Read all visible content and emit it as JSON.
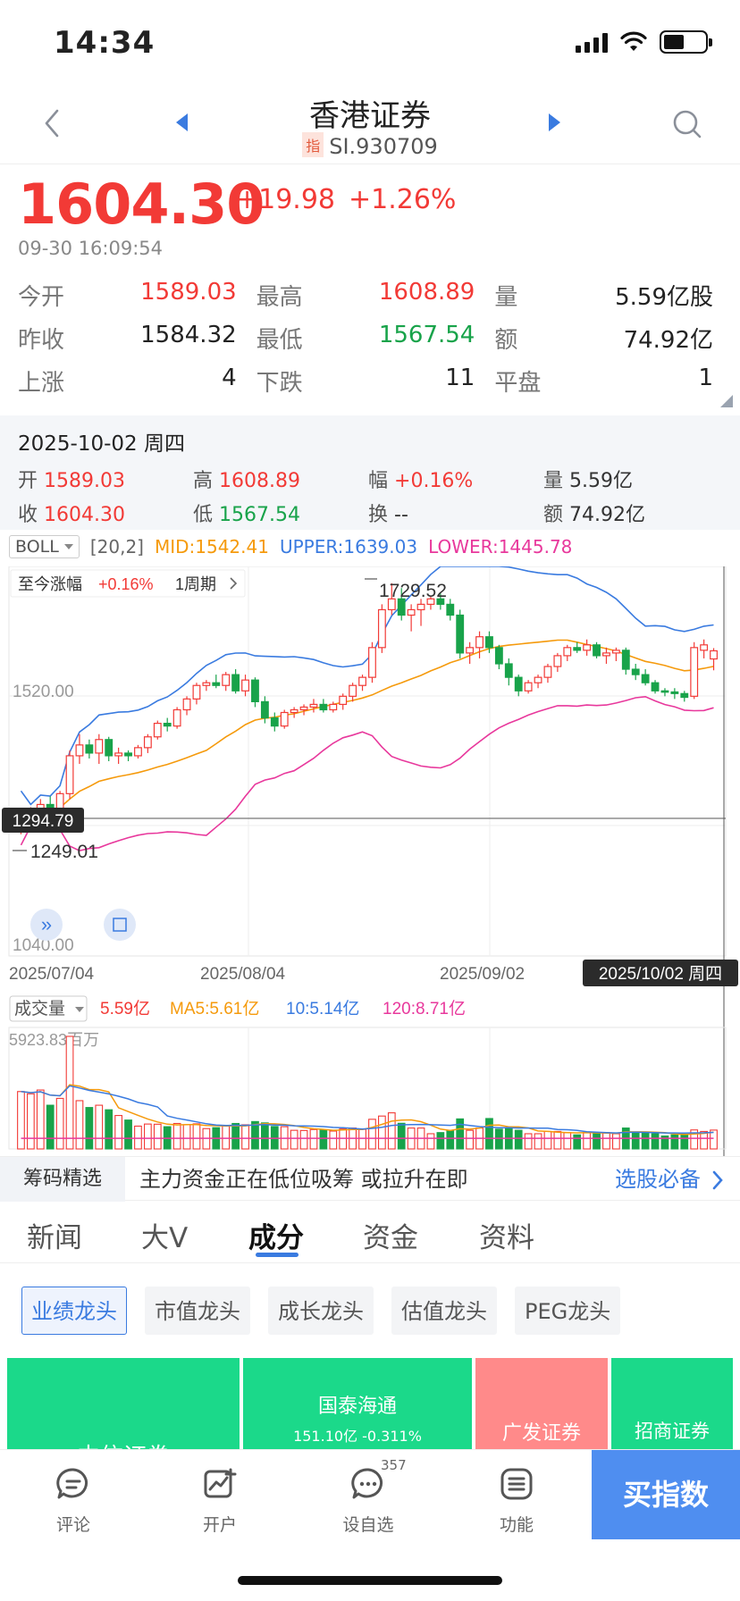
{
  "status": {
    "time": "14:34"
  },
  "nav": {
    "title": "香港证券",
    "tag": "指",
    "code": "SI.930709"
  },
  "quote": {
    "price": "1604.30",
    "change": "+19.98",
    "change_pct": "+1.26%",
    "time": "09-30 16:09:54",
    "rows": [
      [
        {
          "label": "今开",
          "value": "1589.03",
          "color": "red"
        },
        {
          "label": "最高",
          "value": "1608.89",
          "color": "red"
        },
        {
          "label": "量",
          "value": "5.59亿股",
          "color": "dark"
        }
      ],
      [
        {
          "label": "昨收",
          "value": "1584.32",
          "color": "dark"
        },
        {
          "label": "最低",
          "value": "1567.54",
          "color": "green"
        },
        {
          "label": "额",
          "value": "74.92亿",
          "color": "dark"
        }
      ],
      [
        {
          "label": "上涨",
          "value": "4",
          "color": "dark"
        },
        {
          "label": "下跌",
          "value": "11",
          "color": "dark"
        },
        {
          "label": "平盘",
          "value": "1",
          "color": "dark"
        }
      ]
    ]
  },
  "day": {
    "date": "2025-10-02 周四",
    "row1": {
      "open_l": "开",
      "open": "1589.03",
      "high_l": "高",
      "high": "1608.89",
      "amp_l": "幅",
      "amp": "+0.16%",
      "vol_l": "量",
      "vol": "5.59亿"
    },
    "row2": {
      "close_l": "收",
      "close": "1604.30",
      "low_l": "低",
      "low": "1567.54",
      "turn_l": "换",
      "turn": "--",
      "amt_l": "额",
      "amt": "74.92亿"
    }
  },
  "indicator": {
    "name": "BOLL",
    "params": "[20,2]",
    "mid": "MID:1542.41",
    "upper": "UPPER:1639.03",
    "lower": "LOWER:1445.78",
    "colors": {
      "mid": "#f59a0c",
      "upper": "#3a7be0",
      "lower": "#e8389c"
    }
  },
  "chart": {
    "period_label": "至今涨幅",
    "period_value": "+0.16%",
    "period_unit": "1周期",
    "y_label_mid": "1520.00",
    "y_label_low": "1040.00",
    "max_label": "1729.52",
    "min_label": "1249.01",
    "crosshair_price": "1294.79",
    "crosshair_date": "2025/10/02 周四",
    "x_labels": [
      "2025/07/04",
      "2025/08/04",
      "2025/09/02"
    ]
  },
  "chart_data": [
    {
      "type": "candlestick",
      "y_range": [
        1040,
        1760
      ],
      "ohlc": [
        [
          1280,
          1300,
          1265,
          1295
        ],
        [
          1295,
          1315,
          1280,
          1305
        ],
        [
          1305,
          1330,
          1290,
          1320
        ],
        [
          1320,
          1335,
          1305,
          1310
        ],
        [
          1310,
          1345,
          1300,
          1340
        ],
        [
          1340,
          1420,
          1330,
          1410
        ],
        [
          1410,
          1450,
          1395,
          1430
        ],
        [
          1430,
          1440,
          1405,
          1415
        ],
        [
          1415,
          1450,
          1395,
          1440
        ],
        [
          1440,
          1445,
          1400,
          1410
        ],
        [
          1410,
          1425,
          1395,
          1415
        ],
        [
          1415,
          1420,
          1400,
          1410
        ],
        [
          1410,
          1430,
          1405,
          1425
        ],
        [
          1425,
          1450,
          1415,
          1445
        ],
        [
          1445,
          1475,
          1440,
          1470
        ],
        [
          1470,
          1480,
          1455,
          1465
        ],
        [
          1465,
          1500,
          1460,
          1495
        ],
        [
          1495,
          1520,
          1485,
          1515
        ],
        [
          1515,
          1545,
          1505,
          1540
        ],
        [
          1540,
          1550,
          1530,
          1545
        ],
        [
          1545,
          1560,
          1535,
          1540
        ],
        [
          1540,
          1565,
          1530,
          1560
        ],
        [
          1560,
          1570,
          1525,
          1530
        ],
        [
          1530,
          1560,
          1520,
          1550
        ],
        [
          1550,
          1555,
          1500,
          1510
        ],
        [
          1510,
          1520,
          1470,
          1480
        ],
        [
          1480,
          1490,
          1455,
          1465
        ],
        [
          1465,
          1495,
          1460,
          1490
        ],
        [
          1490,
          1500,
          1480,
          1495
        ],
        [
          1495,
          1505,
          1485,
          1500
        ],
        [
          1500,
          1515,
          1490,
          1505
        ],
        [
          1505,
          1515,
          1490,
          1495
        ],
        [
          1495,
          1510,
          1490,
          1505
        ],
        [
          1505,
          1525,
          1495,
          1520
        ],
        [
          1520,
          1545,
          1510,
          1540
        ],
        [
          1540,
          1560,
          1530,
          1555
        ],
        [
          1555,
          1620,
          1545,
          1610
        ],
        [
          1610,
          1690,
          1600,
          1680
        ],
        [
          1680,
          1729,
          1670,
          1700
        ],
        [
          1700,
          1720,
          1660,
          1670
        ],
        [
          1670,
          1690,
          1640,
          1680
        ],
        [
          1680,
          1700,
          1650,
          1690
        ],
        [
          1690,
          1705,
          1680,
          1700
        ],
        [
          1700,
          1710,
          1680,
          1690
        ],
        [
          1690,
          1700,
          1660,
          1670
        ],
        [
          1670,
          1680,
          1590,
          1600
        ],
        [
          1600,
          1620,
          1580,
          1610
        ],
        [
          1610,
          1640,
          1590,
          1630
        ],
        [
          1630,
          1640,
          1600,
          1610
        ],
        [
          1610,
          1615,
          1570,
          1580
        ],
        [
          1580,
          1590,
          1540,
          1555
        ],
        [
          1555,
          1560,
          1520,
          1530
        ],
        [
          1530,
          1550,
          1525,
          1545
        ],
        [
          1545,
          1560,
          1535,
          1555
        ],
        [
          1555,
          1580,
          1545,
          1575
        ],
        [
          1575,
          1600,
          1565,
          1595
        ],
        [
          1595,
          1615,
          1585,
          1610
        ],
        [
          1610,
          1620,
          1600,
          1605
        ],
        [
          1605,
          1625,
          1595,
          1615
        ],
        [
          1615,
          1620,
          1590,
          1595
        ],
        [
          1595,
          1610,
          1580,
          1600
        ],
        [
          1600,
          1610,
          1585,
          1605
        ],
        [
          1605,
          1610,
          1560,
          1570
        ],
        [
          1570,
          1580,
          1550,
          1560
        ],
        [
          1560,
          1570,
          1540,
          1545
        ],
        [
          1545,
          1550,
          1525,
          1530
        ],
        [
          1530,
          1535,
          1520,
          1528
        ],
        [
          1528,
          1535,
          1515,
          1525
        ],
        [
          1525,
          1530,
          1510,
          1518
        ],
        [
          1520,
          1620,
          1515,
          1610
        ],
        [
          1605,
          1625,
          1590,
          1615
        ],
        [
          1589,
          1609,
          1568,
          1604
        ]
      ],
      "boll_mid": "1542.41",
      "boll_upper": "1639.03",
      "boll_lower": "1445.78"
    },
    {
      "type": "bar",
      "title": "成交量",
      "y_max_label": "5923.83百万",
      "latest": "5.59亿",
      "ma5": "MA5:5.61亿",
      "ma10": "10:5.14亿",
      "ma120": "120:8.71亿"
    }
  ],
  "volume": {
    "title": "成交量",
    "latest": "5.59亿",
    "ma5": "MA5:5.61亿",
    "ma10": "10:5.14亿",
    "ma120": "120:8.71亿",
    "max_label": "5923.83百万"
  },
  "promo": {
    "tag": "筹码精选",
    "text": "主力资金正在低位吸筹 或拉升在即",
    "link": "选股必备"
  },
  "tabs": [
    "新闻",
    "大V",
    "成分",
    "资金",
    "资料"
  ],
  "chips": [
    "业绩龙头",
    "市值龙头",
    "成长龙头",
    "估值龙头",
    "PEG龙头"
  ],
  "tiles": [
    {
      "name": "中信证券",
      "sub": "",
      "color": "#1bd98a"
    },
    {
      "name": "国泰海通",
      "sub": "151.10亿 -0.311%",
      "color": "#1bd98a"
    },
    {
      "name": "广发证券",
      "sub": "",
      "color": "#ff8a8a"
    },
    {
      "name": "招商证券",
      "sub": "",
      "color": "#1bd98a"
    }
  ],
  "bottom": {
    "items": [
      "评论",
      "开户",
      "设自选",
      "功能"
    ],
    "badge": "357",
    "buy": "买指数"
  }
}
